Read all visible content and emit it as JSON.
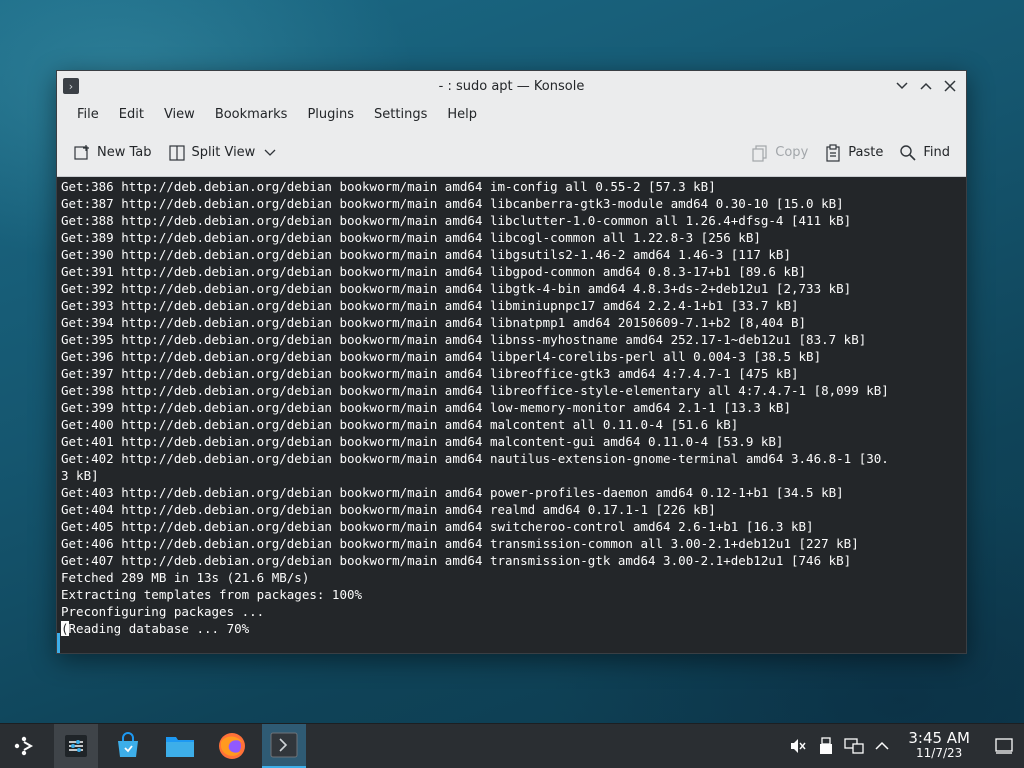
{
  "window": {
    "title": "- : sudo apt — Konsole",
    "app_icon": "terminal-icon",
    "controls": [
      "minimize",
      "maximize",
      "close"
    ]
  },
  "menubar": {
    "items": [
      "File",
      "Edit",
      "View",
      "Bookmarks",
      "Plugins",
      "Settings",
      "Help"
    ]
  },
  "toolbar": {
    "new_tab": "New Tab",
    "split_view": "Split View",
    "copy": "Copy",
    "paste": "Paste",
    "find": "Find"
  },
  "terminal": {
    "lines": [
      "Get:386 http://deb.debian.org/debian bookworm/main amd64 im-config all 0.55-2 [57.3 kB]",
      "Get:387 http://deb.debian.org/debian bookworm/main amd64 libcanberra-gtk3-module amd64 0.30-10 [15.0 kB]",
      "Get:388 http://deb.debian.org/debian bookworm/main amd64 libclutter-1.0-common all 1.26.4+dfsg-4 [411 kB]",
      "Get:389 http://deb.debian.org/debian bookworm/main amd64 libcogl-common all 1.22.8-3 [256 kB]",
      "Get:390 http://deb.debian.org/debian bookworm/main amd64 libgsutils2-1.46-2 amd64 1.46-3 [117 kB]",
      "Get:391 http://deb.debian.org/debian bookworm/main amd64 libgpod-common amd64 0.8.3-17+b1 [89.6 kB]",
      "Get:392 http://deb.debian.org/debian bookworm/main amd64 libgtk-4-bin amd64 4.8.3+ds-2+deb12u1 [2,733 kB]",
      "Get:393 http://deb.debian.org/debian bookworm/main amd64 libminiupnpc17 amd64 2.2.4-1+b1 [33.7 kB]",
      "Get:394 http://deb.debian.org/debian bookworm/main amd64 libnatpmp1 amd64 20150609-7.1+b2 [8,404 B]",
      "Get:395 http://deb.debian.org/debian bookworm/main amd64 libnss-myhostname amd64 252.17-1~deb12u1 [83.7 kB]",
      "Get:396 http://deb.debian.org/debian bookworm/main amd64 libperl4-corelibs-perl all 0.004-3 [38.5 kB]",
      "Get:397 http://deb.debian.org/debian bookworm/main amd64 libreoffice-gtk3 amd64 4:7.4.7-1 [475 kB]",
      "Get:398 http://deb.debian.org/debian bookworm/main amd64 libreoffice-style-elementary all 4:7.4.7-1 [8,099 kB]",
      "Get:399 http://deb.debian.org/debian bookworm/main amd64 low-memory-monitor amd64 2.1-1 [13.3 kB]",
      "Get:400 http://deb.debian.org/debian bookworm/main amd64 malcontent all 0.11.0-4 [51.6 kB]",
      "Get:401 http://deb.debian.org/debian bookworm/main amd64 malcontent-gui amd64 0.11.0-4 [53.9 kB]",
      "Get:402 http://deb.debian.org/debian bookworm/main amd64 nautilus-extension-gnome-terminal amd64 3.46.8-1 [30.",
      "3 kB]",
      "Get:403 http://deb.debian.org/debian bookworm/main amd64 power-profiles-daemon amd64 0.12-1+b1 [34.5 kB]",
      "Get:404 http://deb.debian.org/debian bookworm/main amd64 realmd amd64 0.17.1-1 [226 kB]",
      "Get:405 http://deb.debian.org/debian bookworm/main amd64 switcheroo-control amd64 2.6-1+b1 [16.3 kB]",
      "Get:406 http://deb.debian.org/debian bookworm/main amd64 transmission-common all 3.00-2.1+deb12u1 [227 kB]",
      "Get:407 http://deb.debian.org/debian bookworm/main amd64 transmission-gtk amd64 3.00-2.1+deb12u1 [746 kB]",
      "Fetched 289 MB in 13s (21.6 MB/s)",
      "Extracting templates from packages: 100%",
      "Preconfiguring packages ..."
    ],
    "cursor_char": "(",
    "last_line": "Reading database ... 70%"
  },
  "taskbar": {
    "apps": [
      "launcher-icon",
      "settings-icon",
      "discover-store-icon",
      "file-manager-icon",
      "firefox-icon",
      "konsole-icon"
    ],
    "tray_icons": [
      "volume-muted-icon",
      "usb-device-icon",
      "network-icon",
      "chevron-up-icon"
    ],
    "time": "3:45 AM",
    "date": "11/7/23"
  },
  "colors": {
    "accent": "#3daee9",
    "terminal_bg": "#232629",
    "terminal_fg": "#fcfcfc"
  }
}
